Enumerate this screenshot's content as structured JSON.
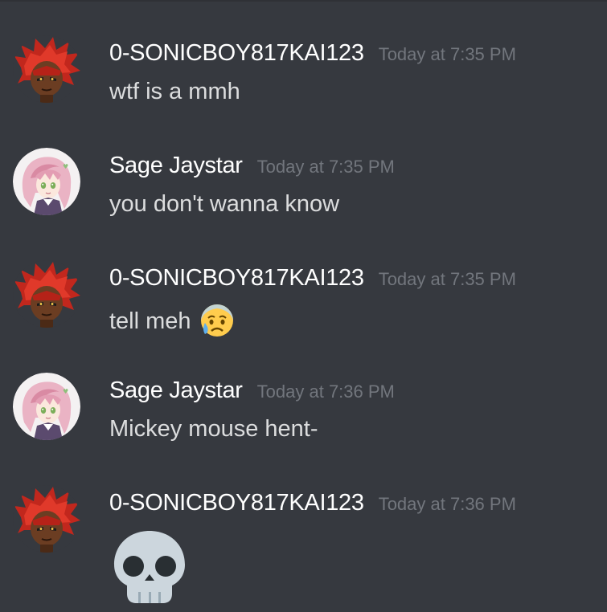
{
  "messages": [
    {
      "username": "0-SONICBOY817KAI123",
      "timestamp": "Today at 7:35 PM",
      "text": "wtf is a mmh",
      "avatar": "red-spiky-hair-avatar"
    },
    {
      "username": "Sage Jaystar",
      "timestamp": "Today at 7:35 PM",
      "text": "you don't wanna know",
      "avatar": "pink-hair-anime-girl-avatar"
    },
    {
      "username": "0-SONICBOY817KAI123",
      "timestamp": "Today at 7:35 PM",
      "text": "tell meh",
      "emoji": "sad-but-relieved-face-emoji",
      "avatar": "red-spiky-hair-avatar"
    },
    {
      "username": "Sage Jaystar",
      "timestamp": "Today at 7:36 PM",
      "text": "Mickey mouse hent-",
      "avatar": "pink-hair-anime-girl-avatar"
    },
    {
      "username": "0-SONICBOY817KAI123",
      "timestamp": "Today at 7:36 PM",
      "emoji": "skull-emoji",
      "avatar": "red-spiky-hair-avatar"
    }
  ],
  "colors": {
    "background": "#36393f",
    "username": "#ffffff",
    "timestamp": "#72767d",
    "message_text": "#dcddde"
  }
}
